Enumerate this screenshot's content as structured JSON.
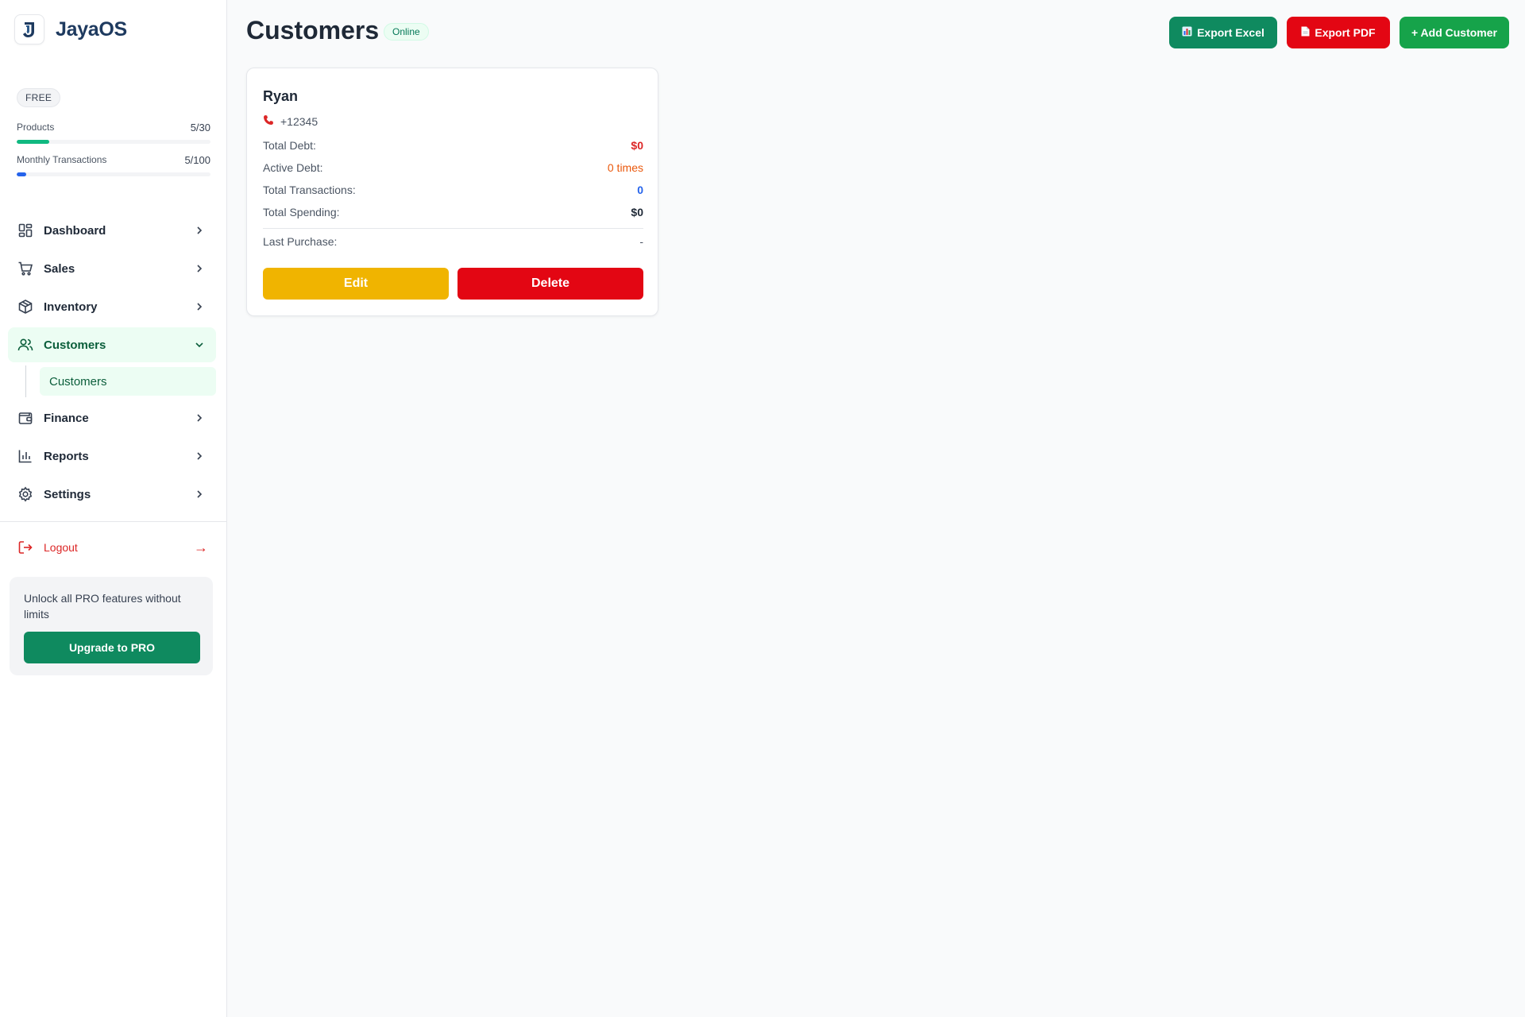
{
  "brand": {
    "name": "JayaOS"
  },
  "plan": {
    "label": "FREE",
    "usage": [
      {
        "label": "Products",
        "value": "5/30",
        "fraction": 0.1667,
        "color": "#10b981"
      },
      {
        "label": "Monthly Transactions",
        "value": "5/100",
        "fraction": 0.05,
        "color": "#2563eb"
      }
    ]
  },
  "nav": {
    "items": [
      {
        "label": "Dashboard",
        "icon": "dashboard-grid-icon"
      },
      {
        "label": "Sales",
        "icon": "shopping-cart-icon"
      },
      {
        "label": "Inventory",
        "icon": "box-icon"
      },
      {
        "label": "Customers",
        "icon": "users-icon",
        "active": true
      },
      {
        "label": "Finance",
        "icon": "wallet-icon"
      },
      {
        "label": "Reports",
        "icon": "bar-chart-icon"
      },
      {
        "label": "Settings",
        "icon": "gear-icon"
      }
    ],
    "sub_items": [
      {
        "label": "Customers",
        "active": true
      }
    ],
    "logout": {
      "label": "Logout",
      "arrow": "→"
    }
  },
  "promo": {
    "text": "Unlock all PRO features without limits",
    "button": "Upgrade to PRO"
  },
  "header": {
    "title": "Customers",
    "status": "Online",
    "buttons": {
      "excel": "Export Excel",
      "pdf": "Export PDF",
      "add": "+ Add Customer"
    }
  },
  "customers": [
    {
      "name": "Ryan",
      "phone": "+12345",
      "total_debt_label": "Total Debt:",
      "total_debt": "$0",
      "active_debt_label": "Active Debt:",
      "active_debt": "0 times",
      "total_transactions_label": "Total Transactions:",
      "total_transactions": "0",
      "total_spending_label": "Total Spending:",
      "total_spending": "$0",
      "last_purchase_label": "Last Purchase:",
      "last_purchase": "-",
      "edit_label": "Edit",
      "delete_label": "Delete"
    }
  ],
  "colors": {
    "primary": "#0f8a5f",
    "danger": "#e30613",
    "warning": "#f0b400",
    "success": "#16a34a",
    "debt": "#dc2626",
    "active_debt": "#ea580c",
    "transactions": "#2563eb"
  }
}
